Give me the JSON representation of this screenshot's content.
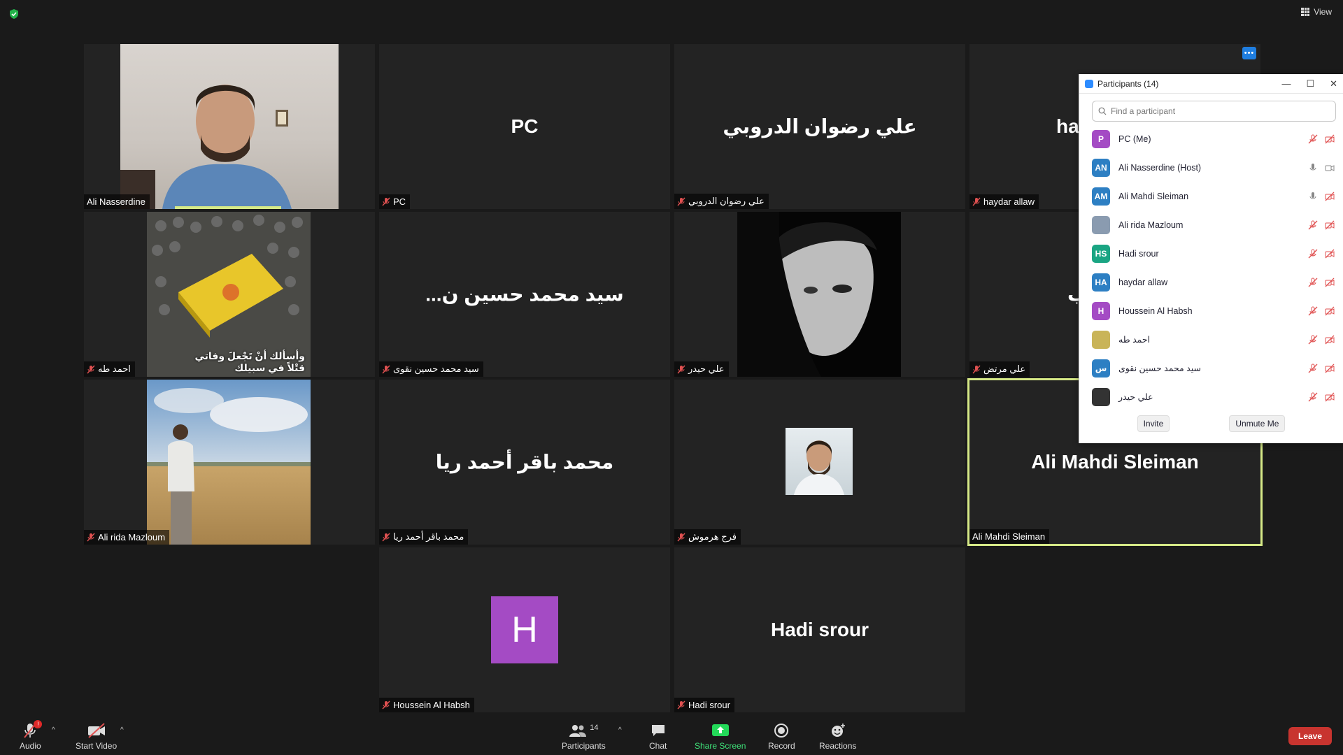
{
  "window": {
    "view_label": "View"
  },
  "tiles": [
    {
      "name": "Ali Nasserdine",
      "big": ""
    },
    {
      "name": "PC",
      "big": "PC"
    },
    {
      "name": "علي رضوان الدروبي",
      "big": "علي رضوان الدروبي"
    },
    {
      "name": "haydar allaw",
      "big": "ha"
    },
    {
      "name": "احمد طه",
      "big": ""
    },
    {
      "name": "سيد محمد حسين نقوى",
      "big": "...سيد محمد حسين ن"
    },
    {
      "name": "علي حيدر",
      "big": ""
    },
    {
      "name": "علي مرتض",
      "big": "ب"
    },
    {
      "name": "Ali rida Mazloum",
      "big": ""
    },
    {
      "name": "محمد باقر أحمد ريا",
      "big": "محمد باقر أحمد ريا"
    },
    {
      "name": "فرج هرموش",
      "big": ""
    },
    {
      "name": "Ali Mahdi Sleiman",
      "big": "Ali Mahdi Sleiman"
    },
    {
      "name": "Houssein Al Habsh",
      "big": "",
      "letter": "H"
    },
    {
      "name": "Hadi srour",
      "big": "Hadi srour"
    }
  ],
  "poster_text": {
    "line1": "وأسألك أنْ تَجْعلَ وفاتي",
    "line2": "قتْلاً في سبيلك"
  },
  "participants_panel": {
    "title": "Participants (14)",
    "search_placeholder": "Find a participant",
    "items": [
      {
        "initials": "P",
        "color": "#a44bc4",
        "name": "PC (Me)"
      },
      {
        "initials": "AN",
        "color": "#2d7fc3",
        "name": "Ali Nasserdine (Host)"
      },
      {
        "initials": "AM",
        "color": "#2d7fc3",
        "name": "Ali Mahdi Sleiman"
      },
      {
        "initials": "",
        "color": "#8a9bb0",
        "name": "Ali rida Mazloum"
      },
      {
        "initials": "HS",
        "color": "#1aa583",
        "name": "Hadi srour"
      },
      {
        "initials": "HA",
        "color": "#2d7fc3",
        "name": "haydar allaw"
      },
      {
        "initials": "H",
        "color": "#a44bc4",
        "name": "Houssein Al Habsh"
      },
      {
        "initials": "",
        "color": "#c9b458",
        "name": "احمد طه"
      },
      {
        "initials": "س",
        "color": "#2d7fc3",
        "name": "سيد محمد حسين نقوى"
      },
      {
        "initials": "",
        "color": "#333333",
        "name": "علي حيدر"
      }
    ],
    "invite_label": "Invite",
    "unmute_label": "Unmute Me"
  },
  "toolbar": {
    "audio": "Audio",
    "audio_badge": "!",
    "video": "Start Video",
    "participants": "Participants",
    "participants_count": "14",
    "chat": "Chat",
    "share": "Share Screen",
    "record": "Record",
    "reactions": "Reactions",
    "leave": "Leave"
  },
  "colors": {
    "accent": "#2d8cff",
    "active_outline": "#d6e987",
    "leave": "#c8342f",
    "share": "#23d959"
  }
}
